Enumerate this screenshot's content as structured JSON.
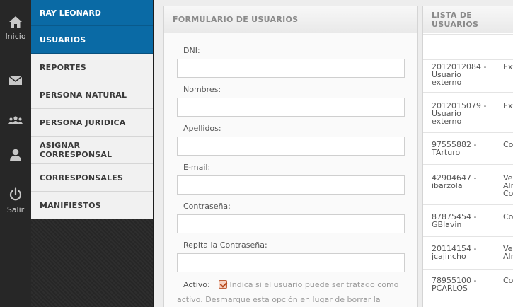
{
  "rail": [
    {
      "icon": "home-icon",
      "label": "Inicio"
    },
    {
      "icon": "mail-icon",
      "label": ""
    },
    {
      "icon": "group-icon",
      "label": ""
    },
    {
      "icon": "user-icon",
      "label": ""
    },
    {
      "icon": "power-icon",
      "label": "Salir"
    }
  ],
  "menu": {
    "user": "RAY LEONARD",
    "items": [
      {
        "label": "USUARIOS",
        "active": true
      },
      {
        "label": "REPORTES"
      },
      {
        "label": "PERSONA NATURAL"
      },
      {
        "label": "PERSONA JURIDICA"
      },
      {
        "label": "ASIGNAR CORRESPONSAL"
      },
      {
        "label": "CORRESPONSALES"
      },
      {
        "label": "MANIFIESTOS"
      }
    ]
  },
  "form": {
    "title": "FORMULARIO DE USUARIOS",
    "fields": [
      {
        "label": "DNI:",
        "value": ""
      },
      {
        "label": "Nombres:",
        "value": ""
      },
      {
        "label": "Apellidos:",
        "value": ""
      },
      {
        "label": "E-mail:",
        "value": ""
      },
      {
        "label": "Contraseña:",
        "value": ""
      },
      {
        "label": "Repita la Contraseña:",
        "value": ""
      }
    ],
    "active_label": "Activo:",
    "active_checked": true,
    "active_hint": "Indica si el usuario puede ser tratado como activo. Desmarque esta opción en lugar de borrar la"
  },
  "list": {
    "title": "LISTA DE USUARIOS",
    "rows": [
      {
        "id": "2012012084 - Usuario externo",
        "type": "Ext"
      },
      {
        "id": "2012015079 - Usuario externo",
        "type": "Ext"
      },
      {
        "id": "97555882 - TArturo",
        "type": "Co"
      },
      {
        "id": "42904647 - ibarzola",
        "type": "Ver Alm Co"
      },
      {
        "id": "87875454 - GBlavin",
        "type": "Co"
      },
      {
        "id": "20114154 - jcajincho",
        "type": "Ver Alm"
      },
      {
        "id": "78955100 - PCARLOS",
        "type": "Co"
      }
    ]
  },
  "colors": {
    "accent": "#0a6aa5",
    "rail": "#272727",
    "checkbox": "#c0603a"
  }
}
